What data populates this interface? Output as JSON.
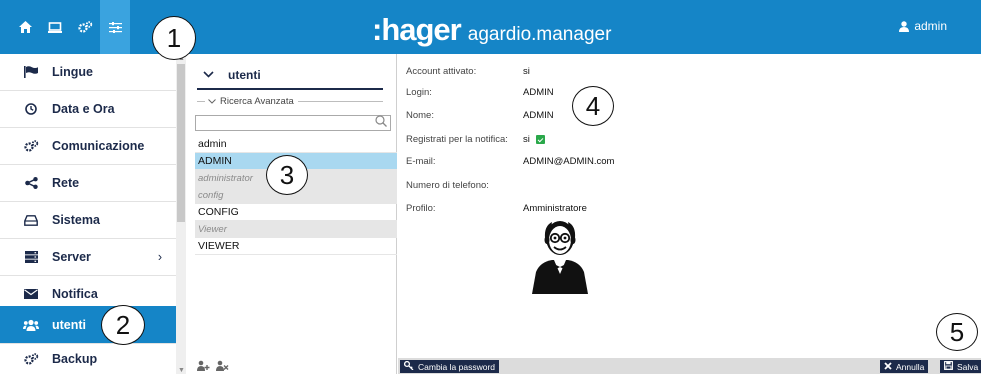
{
  "app": {
    "brand": ":hager",
    "product": "agardio.manager",
    "user": "admin"
  },
  "topnav": [
    {
      "icon": "home-icon",
      "glyph": "⌂"
    },
    {
      "icon": "monitor-icon",
      "glyph": "▭"
    },
    {
      "icon": "gears-icon",
      "glyph": "⚙"
    },
    {
      "icon": "sliders-icon",
      "glyph": "≡"
    }
  ],
  "sidebar": {
    "items": [
      {
        "label": "Lingue",
        "icon": "flag-icon"
      },
      {
        "label": "Data e Ora",
        "icon": "clock-icon"
      },
      {
        "label": "Comunicazione",
        "icon": "gears-icon"
      },
      {
        "label": "Rete",
        "icon": "share-icon"
      },
      {
        "label": "Sistema",
        "icon": "hdd-icon"
      },
      {
        "label": "Server",
        "icon": "server-icon",
        "chevron": "›"
      },
      {
        "label": "Notifica",
        "icon": "envelope-icon"
      },
      {
        "label": "utenti",
        "icon": "users-icon",
        "active": true
      },
      {
        "label": "Backup",
        "icon": "gears-icon"
      }
    ]
  },
  "userlist": {
    "header": "utenti",
    "advanced_search": "Ricerca Avanzata",
    "search_value": "",
    "rows": [
      {
        "text": "admin",
        "type": "user"
      },
      {
        "text": "ADMIN",
        "type": "user",
        "selected": true
      },
      {
        "text": "administrator",
        "type": "group"
      },
      {
        "text": "config",
        "type": "group"
      },
      {
        "text": "CONFIG",
        "type": "user"
      },
      {
        "text": "Viewer",
        "type": "group"
      },
      {
        "text": "VIEWER",
        "type": "user"
      }
    ]
  },
  "detail": {
    "fields": [
      {
        "label": "Account attivato:",
        "value": "si"
      },
      {
        "label": "Login:",
        "value": "ADMIN"
      },
      {
        "label": "Nome:",
        "value": "ADMIN"
      },
      {
        "label": "Registrati per la notifica:",
        "value": "si"
      },
      {
        "label": "E-mail:",
        "value": "ADMIN@ADMIN.com"
      },
      {
        "label": "Numero di telefono:",
        "value": ""
      },
      {
        "label": "Profilo:",
        "value": "Amministratore"
      }
    ]
  },
  "bottombar": {
    "change_password": "Cambia la password",
    "cancel": "Annulla",
    "save": "Salva"
  },
  "callouts": [
    "1",
    "2",
    "3",
    "4",
    "5"
  ],
  "colors": {
    "accent": "#1585c7",
    "active_tab": "#3aa3df",
    "navy": "#1c2a4a",
    "selected_row": "#a9d8f0",
    "check_green": "#2aa84a"
  }
}
